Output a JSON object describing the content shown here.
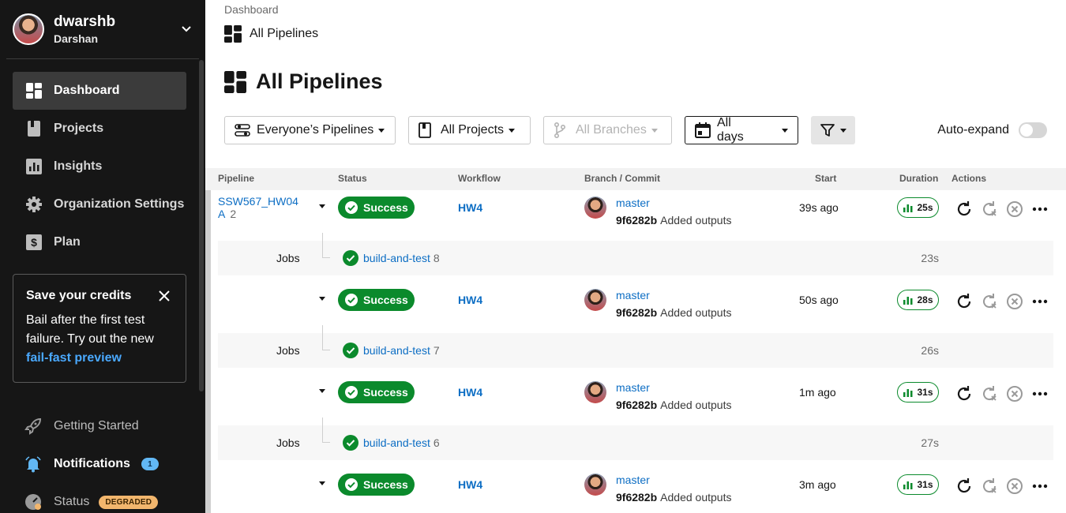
{
  "user": {
    "name": "dwarshb",
    "org": "Darshan"
  },
  "sidebar": {
    "items": [
      {
        "label": "Dashboard",
        "icon": "dashboard-icon",
        "active": true
      },
      {
        "label": "Projects",
        "icon": "book-icon"
      },
      {
        "label": "Insights",
        "icon": "chart-icon"
      },
      {
        "label": "Organization Settings",
        "icon": "gear-icon"
      },
      {
        "label": "Plan",
        "icon": "dollar-icon"
      }
    ],
    "promo": {
      "title": "Save your credits",
      "body": "Bail after the first test failure. Try out the new",
      "link": "fail-fast preview"
    },
    "bottom": {
      "getting_started": "Getting Started",
      "notifications": "Notifications",
      "notifications_count": "1",
      "status": "Status",
      "status_badge": "DEGRADED"
    }
  },
  "breadcrumb": {
    "parent": "Dashboard",
    "current": "All Pipelines"
  },
  "page": {
    "title": "All Pipelines"
  },
  "filters": {
    "pipelines": "Everyone’s Pipelines",
    "projects": "All Projects",
    "branches": "All Branches",
    "days": "All days",
    "auto_expand": "Auto-expand"
  },
  "table": {
    "headers": {
      "pipeline": "Pipeline",
      "status": "Status",
      "workflow": "Workflow",
      "branch": "Branch / Commit",
      "start": "Start",
      "duration": "Duration",
      "actions": "Actions"
    },
    "rows": [
      {
        "pipeline": "SSW567_HW04A",
        "number": "2",
        "status": "Success",
        "workflow": "HW4",
        "branch": "master",
        "sha": "9f6282b",
        "message": "Added outputs",
        "start": "39s ago",
        "duration": "25s",
        "jobs_label": "Jobs",
        "job_name": "build-and-test",
        "job_number": "8",
        "job_duration": "23s"
      },
      {
        "pipeline": "",
        "number": "",
        "status": "Success",
        "workflow": "HW4",
        "branch": "master",
        "sha": "9f6282b",
        "message": "Added outputs",
        "start": "50s ago",
        "duration": "28s",
        "jobs_label": "Jobs",
        "job_name": "build-and-test",
        "job_number": "7",
        "job_duration": "26s"
      },
      {
        "pipeline": "",
        "number": "",
        "status": "Success",
        "workflow": "HW4",
        "branch": "master",
        "sha": "9f6282b",
        "message": "Added outputs",
        "start": "1m ago",
        "duration": "31s",
        "jobs_label": "Jobs",
        "job_name": "build-and-test",
        "job_number": "6",
        "job_duration": "27s"
      },
      {
        "pipeline": "",
        "number": "",
        "status": "Success",
        "workflow": "HW4",
        "branch": "master",
        "sha": "9f6282b",
        "message": "Added outputs",
        "start": "3m ago",
        "duration": "31s"
      }
    ]
  },
  "colors": {
    "success": "#0b8a2c",
    "link": "#0d6ec4",
    "sidebar_bg": "#161616"
  }
}
